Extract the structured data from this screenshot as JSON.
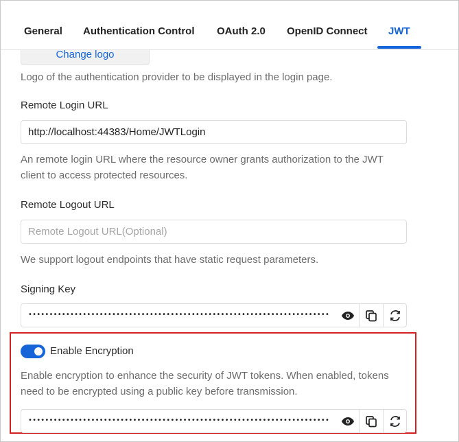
{
  "tabs": [
    {
      "label": "General"
    },
    {
      "label": "Authentication Control"
    },
    {
      "label": "OAuth 2.0"
    },
    {
      "label": "OpenID Connect"
    },
    {
      "label": "JWT"
    }
  ],
  "logo": {
    "button_label": "Change logo",
    "help": "Logo of the authentication provider to be displayed in the login page."
  },
  "remote_login": {
    "label": "Remote Login URL",
    "value": "http://localhost:44383/Home/JWTLogin",
    "help_line1": "An remote login URL where the resource owner grants authorization to the JWT",
    "help_line2": "client to access protected resources."
  },
  "remote_logout": {
    "label": "Remote Logout URL",
    "placeholder": "Remote Logout URL(Optional)",
    "help": "We support logout endpoints that have static request parameters."
  },
  "signing_key": {
    "label": "Signing Key",
    "masked": "••••••••••••••••••••••••••••••••••••••••••••••••••••••••••••••••••••••••••••••••••••••••••••••••••••••••••••••••"
  },
  "encryption": {
    "toggle_label": "Enable Encryption",
    "enabled": true,
    "help_line1": "Enable encryption to enhance the security of JWT tokens. When enabled, tokens",
    "help_line2": "need to be encrypted using a public key before transmission.",
    "masked": "••••••••••••••••••••••••••••••••••••••••••••••••••••••••••••••••••••••••••••••••••••••••••••••••••••••••••••••••"
  },
  "icons": {
    "show": "eye-icon",
    "copy": "copy-icon",
    "regenerate": "refresh-icon"
  },
  "colors": {
    "accent": "#1565d8",
    "highlight": "#d21f1f"
  }
}
